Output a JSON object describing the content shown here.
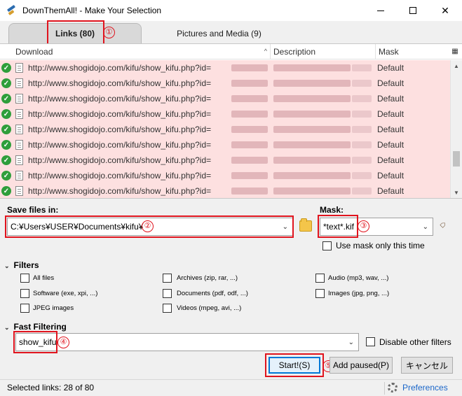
{
  "window": {
    "title": "DownThemAll! - Make Your Selection",
    "minimize": "—",
    "maximize": "☐",
    "close": "✕"
  },
  "tabs": [
    {
      "label": "Links (80)",
      "selected": true
    },
    {
      "label": "Pictures and Media (9)",
      "selected": false
    }
  ],
  "table": {
    "columns": [
      "Download",
      "Description",
      "Mask"
    ],
    "sort_indicator": "^",
    "rows": [
      {
        "url": "http://www.shogidojo.com/kifu/show_kifu.php?id=",
        "mask": "Default"
      },
      {
        "url": "http://www.shogidojo.com/kifu/show_kifu.php?id=",
        "mask": "Default"
      },
      {
        "url": "http://www.shogidojo.com/kifu/show_kifu.php?id=",
        "mask": "Default"
      },
      {
        "url": "http://www.shogidojo.com/kifu/show_kifu.php?id=",
        "mask": "Default"
      },
      {
        "url": "http://www.shogidojo.com/kifu/show_kifu.php?id=",
        "mask": "Default"
      },
      {
        "url": "http://www.shogidojo.com/kifu/show_kifu.php?id=",
        "mask": "Default"
      },
      {
        "url": "http://www.shogidojo.com/kifu/show_kifu.php?id=",
        "mask": "Default"
      },
      {
        "url": "http://www.shogidojo.com/kifu/show_kifu.php?id=",
        "mask": "Default"
      },
      {
        "url": "http://www.shogidojo.com/kifu/show_kifu.php?id=",
        "mask": "Default"
      }
    ]
  },
  "save": {
    "label": "Save files in:",
    "path": "C:¥Users¥USER¥Documents¥kifu¥"
  },
  "mask": {
    "label": "Mask:",
    "value": "*text*.kif",
    "use_once_label": "Use mask only this time"
  },
  "filters": {
    "header": "Filters",
    "items": [
      "All files",
      "Archives (zip, rar, ...)",
      "Audio (mp3, wav, ...)",
      "Software (exe, xpi, ...)",
      "Documents (pdf, odf, ...)",
      "Images (jpg, png, ...)",
      "JPEG images",
      "Videos (mpeg, avi, ...)"
    ]
  },
  "fast_filtering": {
    "header": "Fast Filtering",
    "value": "show_kifu",
    "disable_label": "Disable other filters"
  },
  "buttons": {
    "start": "Start!(S)",
    "add_paused": "Add paused(P)",
    "cancel": "キャンセル"
  },
  "status": {
    "selected": "Selected links: 28 of 80",
    "preferences": "Preferences"
  },
  "annotations": [
    "①",
    "②",
    "③",
    "④",
    "⑤"
  ],
  "colors": {
    "row_bg": "#fde0e0",
    "highlight": "#e0141e",
    "link": "#1a66c9",
    "check": "#2e9e3b"
  }
}
